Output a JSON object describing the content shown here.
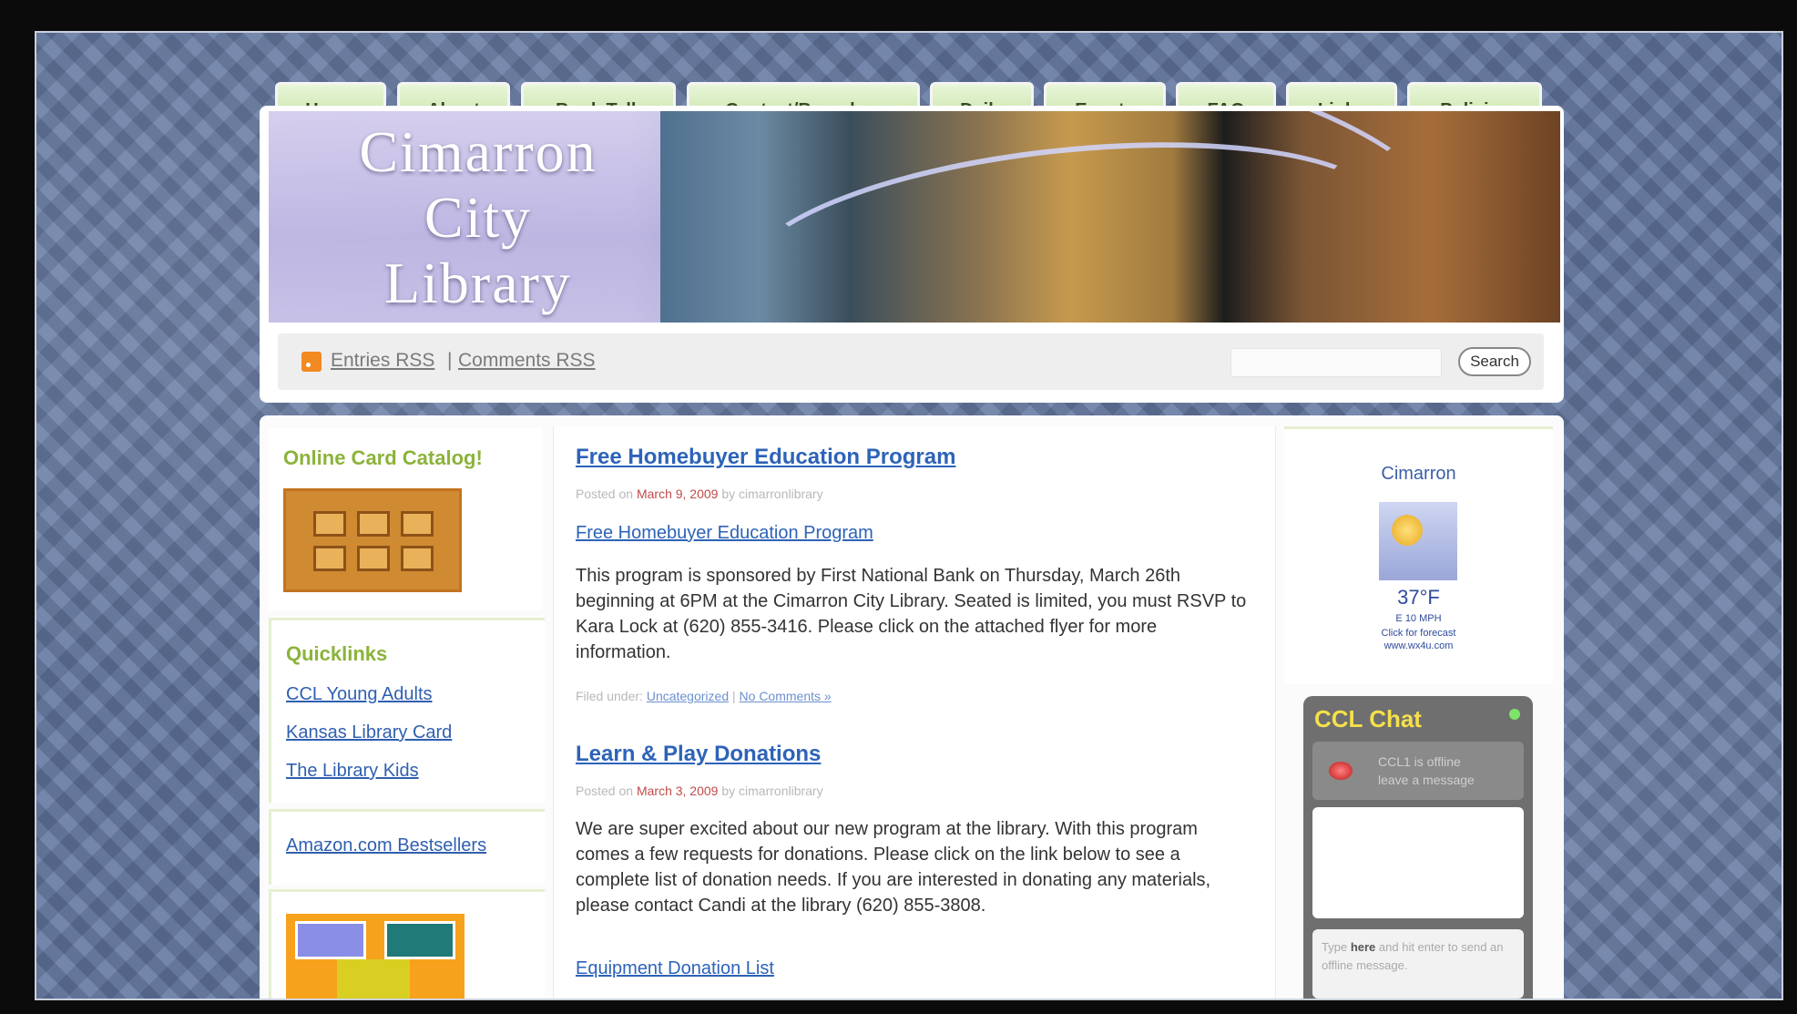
{
  "nav": {
    "tabs": [
      "Home",
      "About",
      "Book Talk",
      "Contact/Branches",
      "Daily",
      "Events",
      "FAQ",
      "Links",
      "Policies"
    ]
  },
  "header": {
    "title_lines": [
      "Cimarron",
      "City",
      "Library"
    ],
    "entries_rss": "Entries RSS",
    "separator": "|",
    "comments_rss": "Comments RSS",
    "search_placeholder": "",
    "search_label": "Search"
  },
  "sidebar_left": {
    "catalog_heading": "Online Card Catalog!",
    "quicklinks_heading": "Quicklinks",
    "quicklinks": [
      "CCL Young Adults",
      "Kansas Library Card",
      "The Library Kids"
    ],
    "amazon_link": "Amazon.com Bestsellers"
  },
  "posts": [
    {
      "title": "Free Homebuyer Education Program",
      "meta_prefix": "Posted on",
      "date": "March 9, 2009",
      "meta_by": "by cimarronlibrary",
      "link": "Free Homebuyer Education Program",
      "body": "This program is sponsored  by First National Bank on Thursday, March 26th beginning at 6PM at the Cimarron City Library. Seated is limited, you must RSVP to Kara Lock at (620) 855-3416. Please click on the attached flyer for more information.",
      "filed_prefix": "Filed under:",
      "category": "Uncategorized",
      "comments": "No Comments »"
    },
    {
      "title": "Learn & Play Donations",
      "meta_prefix": "Posted on",
      "date": "March 3, 2009",
      "meta_by": "by cimarronlibrary",
      "body": "We are super excited about our new program at the library. With this program comes a few requests for donations. Please click on the link below to see a complete list of donation needs. If you are interested in donating any materials, please contact Candi at the library (620) 855-3808.",
      "link": "Equipment Donation List"
    }
  ],
  "weather": {
    "city": "Cimarron",
    "temp": "37°F",
    "wind": "E 10 MPH",
    "cta": "Click for forecast",
    "site": "www.wx4u.com"
  },
  "chat": {
    "title": "CCL Chat",
    "status_line1": "CCL1 is offline",
    "status_line2": "leave a message",
    "input_hint_1": "Type",
    "input_hint_bold": "here",
    "input_hint_2": "and hit enter to send an offline message."
  },
  "colors": {
    "tab_green": "#b9dc95",
    "link_blue": "#2d63b8",
    "heading_green": "#8bb33a",
    "date_red": "#c24a4a",
    "chat_yellow": "#f5e04a"
  }
}
